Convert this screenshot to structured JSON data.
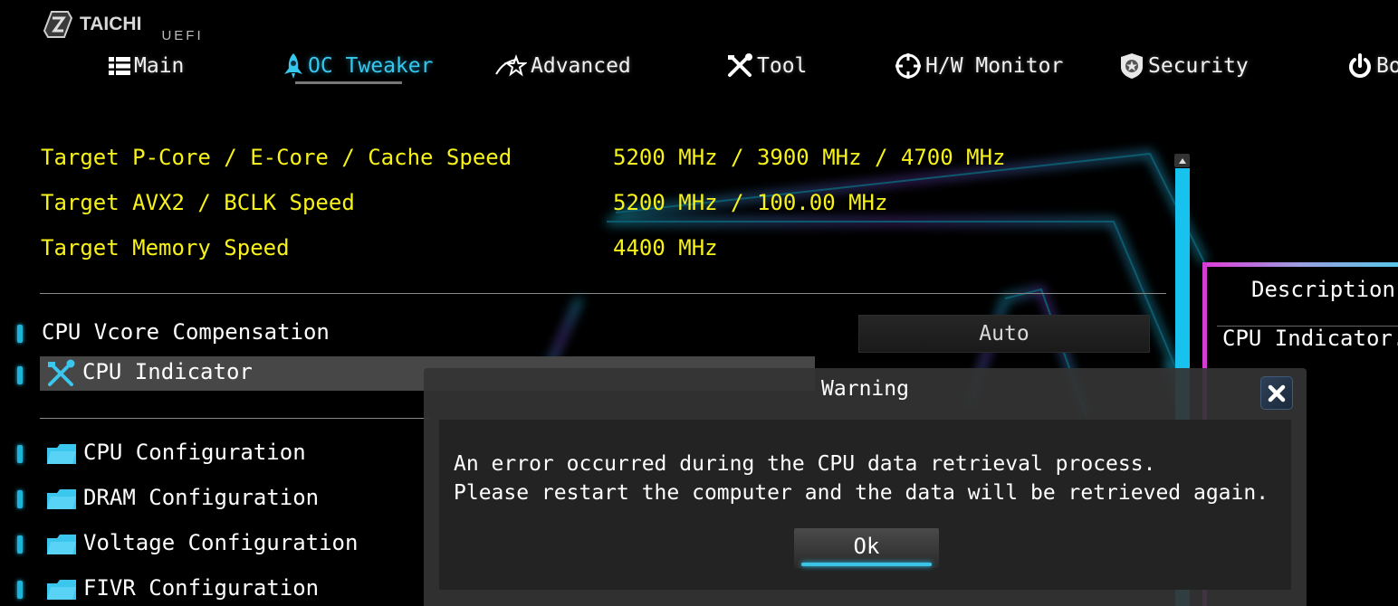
{
  "app": {
    "brand": "TAICHI",
    "subtitle": "UEFI"
  },
  "nav": {
    "tabs": [
      {
        "label": "Main",
        "icon": "list-icon",
        "active": false
      },
      {
        "label": "OC Tweaker",
        "icon": "rocket-icon",
        "active": true
      },
      {
        "label": "Advanced",
        "icon": "star-icon",
        "active": false
      },
      {
        "label": "Tool",
        "icon": "tools-icon",
        "active": false
      },
      {
        "label": "H/W Monitor",
        "icon": "crosshair-icon",
        "active": false
      },
      {
        "label": "Security",
        "icon": "shield-badge-icon",
        "active": false
      },
      {
        "label": "Bo",
        "icon": "power-icon",
        "active": false
      }
    ]
  },
  "info": [
    {
      "label": "Target P-Core / E-Core / Cache Speed",
      "value": "5200 MHz / 3900 MHz / 4700 MHz"
    },
    {
      "label": "Target AVX2 / BCLK Speed",
      "value": "5200 MHz / 100.00 MHz"
    },
    {
      "label": "Target Memory Speed",
      "value": "4400 MHz"
    }
  ],
  "settings": {
    "vcore": {
      "label": "CPU Vcore Compensation",
      "value": "Auto"
    },
    "indicator": {
      "label": "CPU Indicator",
      "icon": "tools-icon"
    },
    "folders": [
      {
        "label": "CPU Configuration"
      },
      {
        "label": "DRAM Configuration"
      },
      {
        "label": "Voltage Configuration"
      },
      {
        "label": "FIVR Configuration"
      }
    ]
  },
  "description": {
    "title": "Description",
    "text": "CPU Indicator."
  },
  "dialog": {
    "title": "Warning",
    "message": "An error occurred during the CPU data retrieval process.\nPlease restart the computer and the data will be retrieved again.",
    "ok_label": "Ok",
    "close_icon": "close-icon"
  },
  "colors": {
    "accent": "#35c7ec",
    "info_text": "#f7f21a",
    "description_border": "#d63bd6",
    "selected_row": "#474747"
  }
}
